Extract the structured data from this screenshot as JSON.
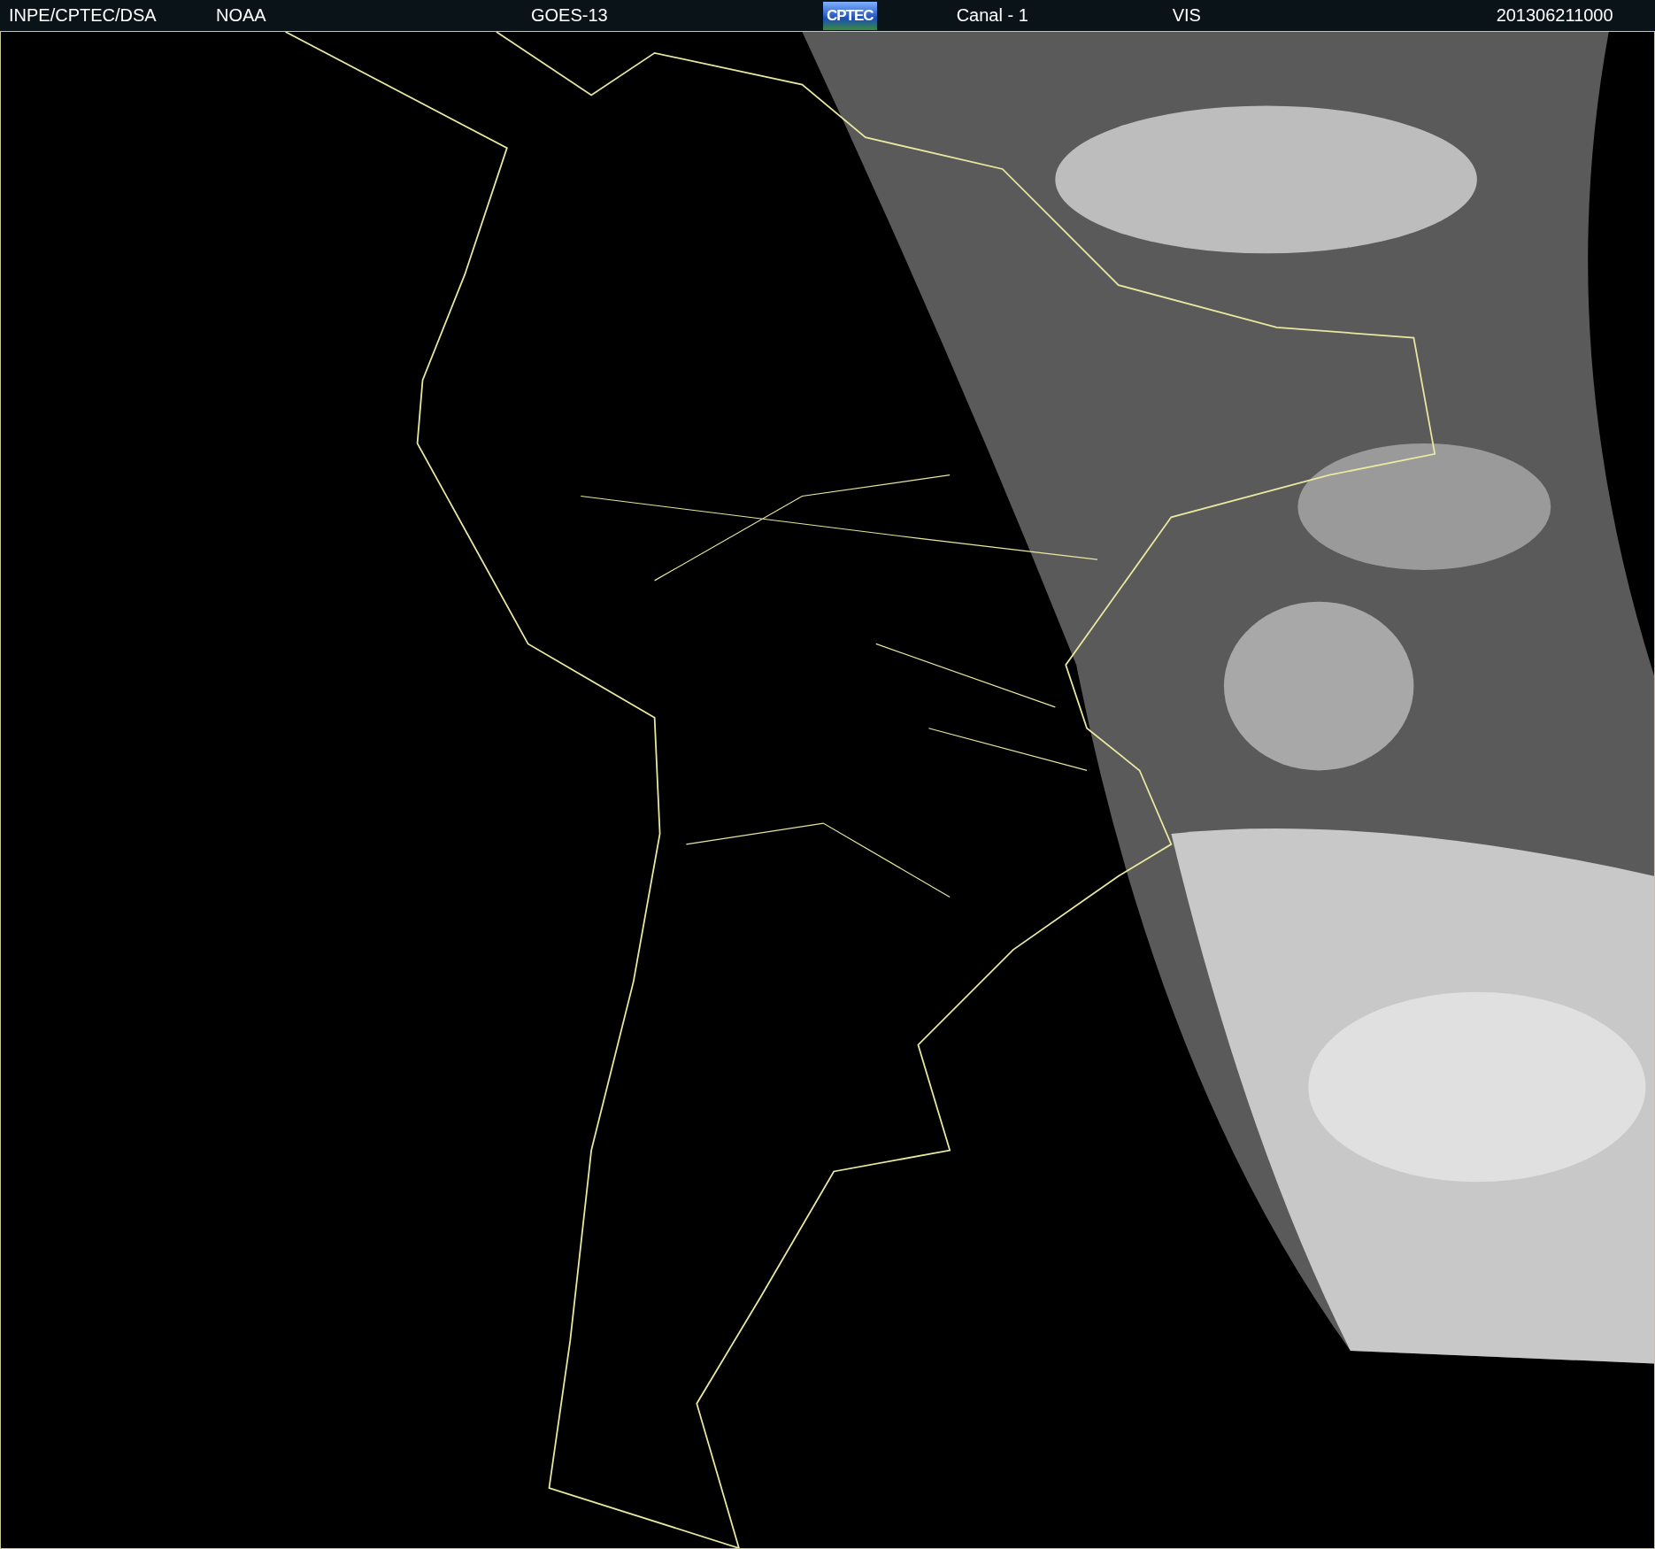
{
  "header": {
    "items": [
      {
        "kind": "text",
        "text": "INPE/CPTEC/DSA"
      },
      {
        "kind": "text",
        "text": "NOAA"
      },
      {
        "kind": "text",
        "text": "GOES-13"
      },
      {
        "kind": "logo",
        "text": "CPTEC"
      },
      {
        "kind": "text",
        "text": "Canal - 1"
      },
      {
        "kind": "text",
        "text": "VIS"
      },
      {
        "kind": "text",
        "text": "201306211000"
      }
    ]
  }
}
